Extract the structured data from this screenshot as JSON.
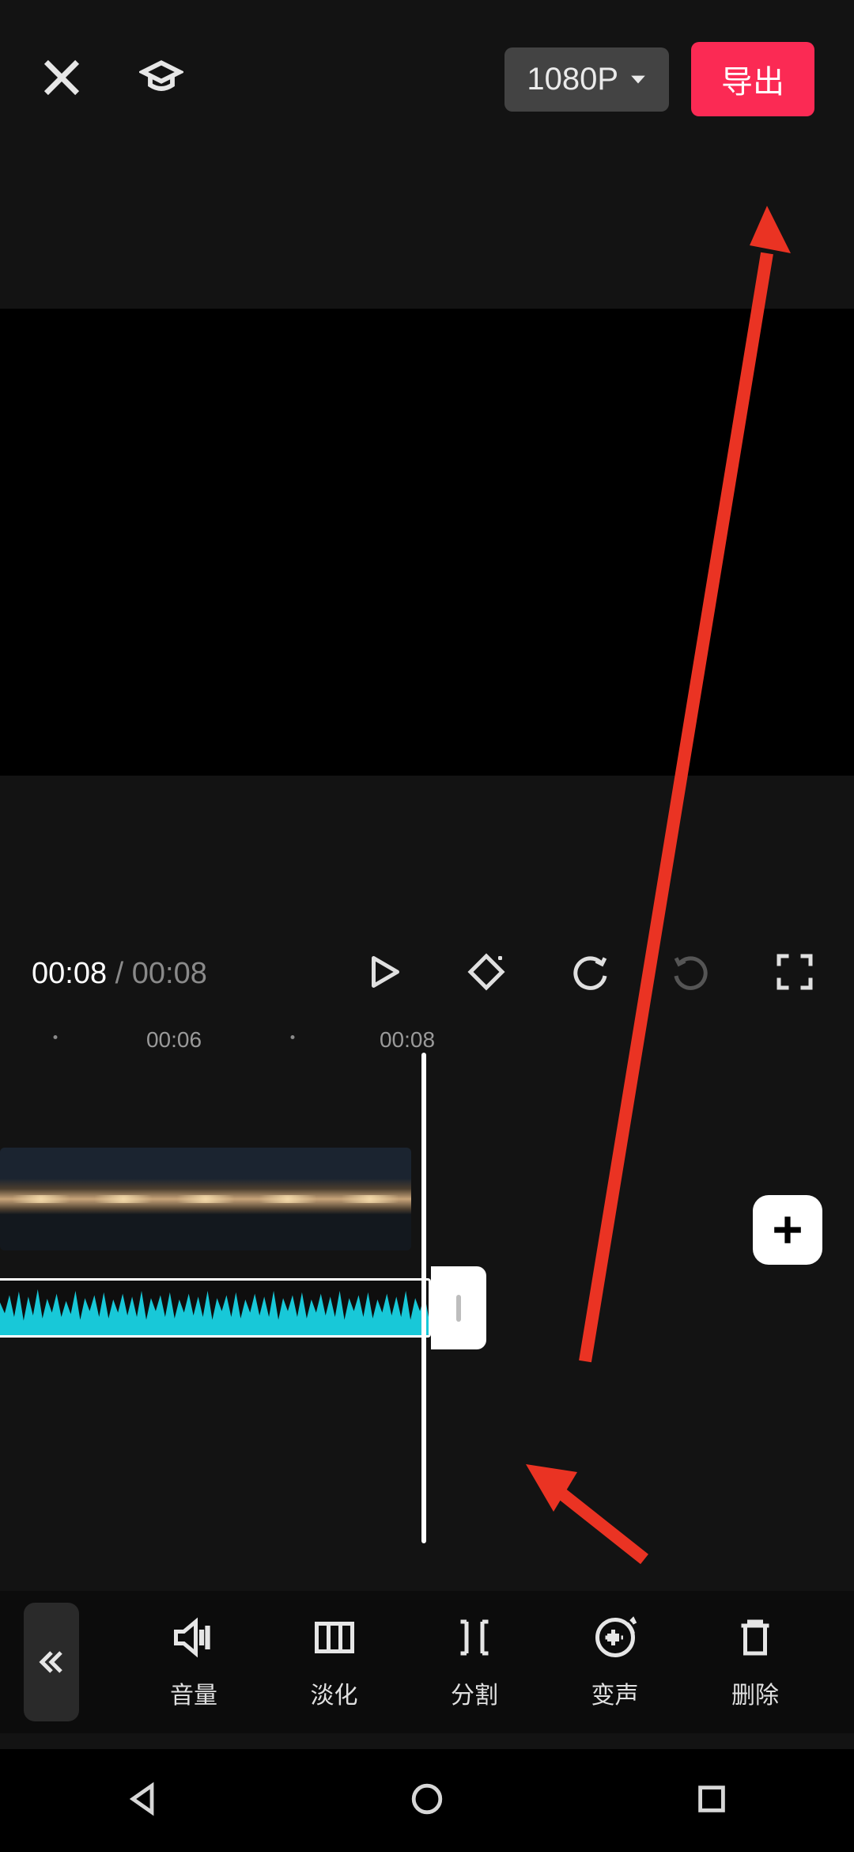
{
  "header": {
    "resolution_label": "1080P",
    "export_label": "导出"
  },
  "playback": {
    "current_time": "00:08",
    "separator": " / ",
    "total_time": "00:08"
  },
  "ruler": {
    "ticks": [
      "00:06",
      "00:08"
    ]
  },
  "tools": {
    "items": [
      {
        "id": "volume",
        "label": "音量"
      },
      {
        "id": "fade",
        "label": "淡化"
      },
      {
        "id": "split",
        "label": "分割"
      },
      {
        "id": "voice",
        "label": "变声"
      },
      {
        "id": "delete",
        "label": "删除"
      }
    ]
  },
  "icons": {
    "close": "close-icon",
    "tutorial": "graduation-cap-icon",
    "play": "play-icon",
    "keyframe": "keyframe-icon",
    "undo": "undo-icon",
    "redo": "redo-icon",
    "fullscreen": "fullscreen-icon",
    "add": "plus-icon",
    "back": "chevron-double-left-icon"
  },
  "colors": {
    "accent": "#fb2a54",
    "waveform": "#18c8d8",
    "annotation": "#ea3323"
  }
}
